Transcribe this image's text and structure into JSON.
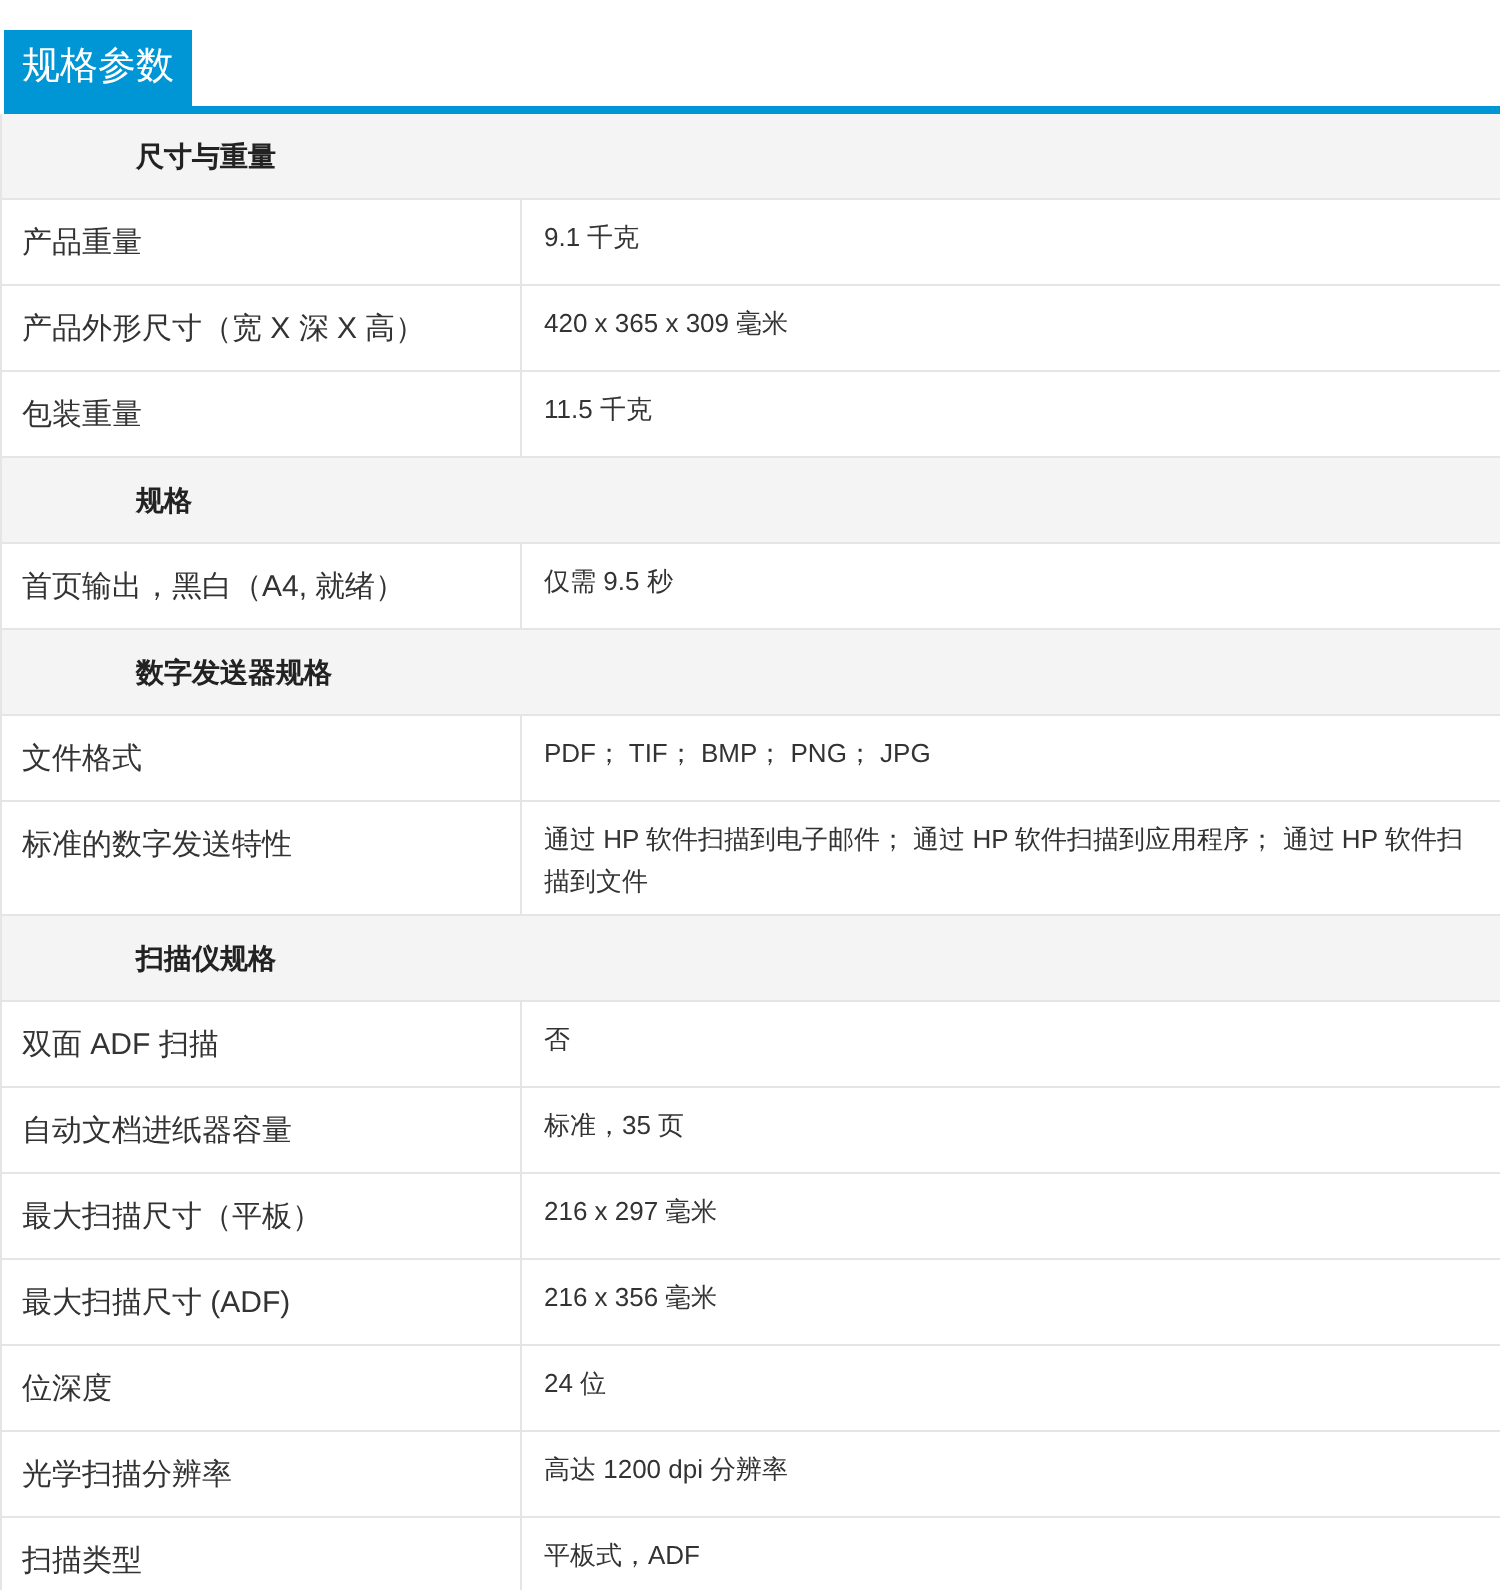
{
  "tab": {
    "label": "规格参数"
  },
  "rows": [
    {
      "kind": "section",
      "label": "尺寸与重量"
    },
    {
      "kind": "row",
      "label": "产品重量",
      "value": "9.1 千克"
    },
    {
      "kind": "row",
      "label": "产品外形尺寸（宽 X 深 X 高）",
      "value": "420 x 365 x 309 毫米"
    },
    {
      "kind": "row",
      "label": "包装重量",
      "value": "11.5 千克"
    },
    {
      "kind": "section",
      "label": "规格"
    },
    {
      "kind": "row",
      "label": "首页输出，黑白（A4, 就绪）",
      "value": "仅需 9.5 秒"
    },
    {
      "kind": "section",
      "label": "数字发送器规格"
    },
    {
      "kind": "row",
      "label": "文件格式",
      "value": "PDF； TIF； BMP； PNG； JPG"
    },
    {
      "kind": "row",
      "label": "标准的数字发送特性",
      "value": "通过 HP 软件扫描到电子邮件； 通过 HP 软件扫描到应用程序； 通过 HP 软件扫描到文件"
    },
    {
      "kind": "section",
      "label": "扫描仪规格"
    },
    {
      "kind": "row",
      "label": "双面 ADF 扫描",
      "value": "否"
    },
    {
      "kind": "row",
      "label": "自动文档进纸器容量",
      "value": "标准，35 页"
    },
    {
      "kind": "row",
      "label": "最大扫描尺寸（平板）",
      "value": "216 x 297 毫米"
    },
    {
      "kind": "row",
      "label": "最大扫描尺寸 (ADF)",
      "value": "216 x 356 毫米"
    },
    {
      "kind": "row",
      "label": "位深度",
      "value": "24 位"
    },
    {
      "kind": "row",
      "label": "光学扫描分辨率",
      "value": "高达 1200 dpi 分辨率"
    },
    {
      "kind": "row",
      "label": "扫描类型",
      "value": "平板式，ADF"
    }
  ]
}
